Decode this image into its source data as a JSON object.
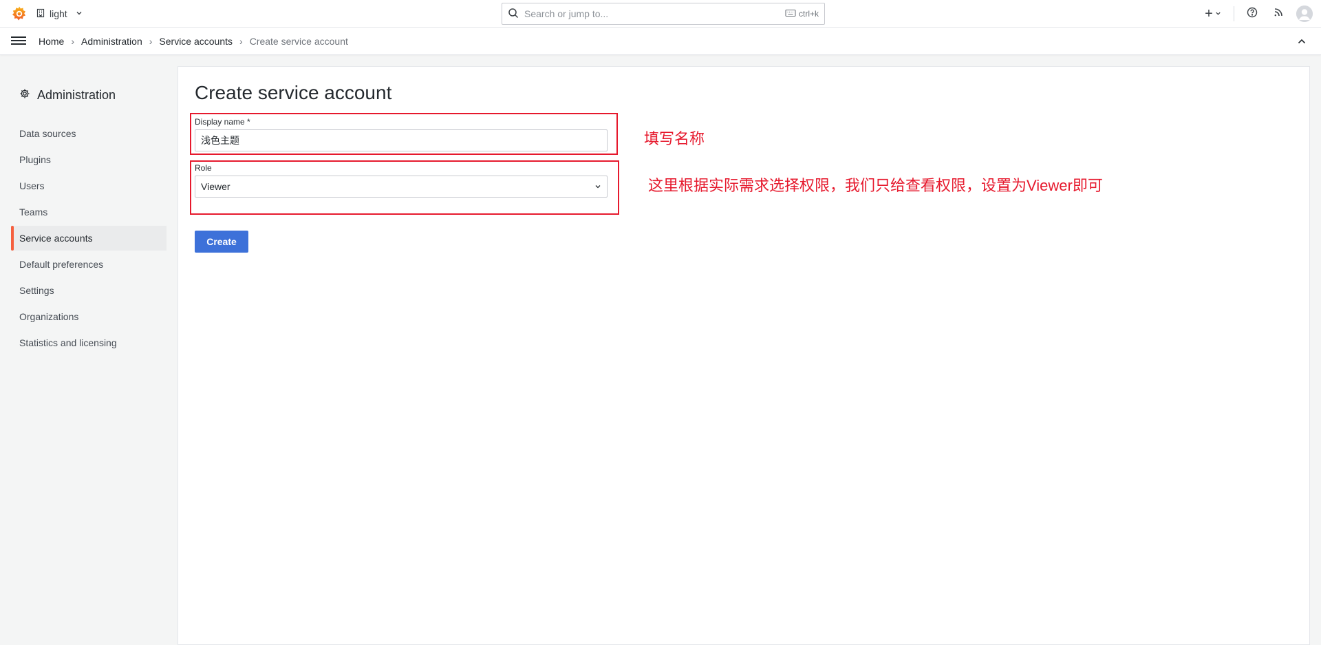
{
  "topbar": {
    "org_name": "light",
    "search_placeholder": "Search or jump to...",
    "search_shortcut": "ctrl+k",
    "new_symbol": "+"
  },
  "breadcrumb": {
    "items": [
      "Home",
      "Administration",
      "Service accounts"
    ],
    "current": "Create service account"
  },
  "sidebar": {
    "title": "Administration",
    "items": [
      {
        "label": "Data sources"
      },
      {
        "label": "Plugins"
      },
      {
        "label": "Users"
      },
      {
        "label": "Teams"
      },
      {
        "label": "Service accounts",
        "active": true
      },
      {
        "label": "Default preferences"
      },
      {
        "label": "Settings"
      },
      {
        "label": "Organizations"
      },
      {
        "label": "Statistics and licensing"
      }
    ]
  },
  "main": {
    "title": "Create service account",
    "display_name_label": "Display name *",
    "display_name_value": "浅色主题",
    "role_label": "Role",
    "role_value": "Viewer",
    "create_label": "Create"
  },
  "annotations": {
    "name_note": "填写名称",
    "role_note": "这里根据实际需求选择权限，我们只给查看权限，设置为Viewer即可"
  },
  "colors": {
    "accent": "#3d71d9",
    "active_indicator": "#f55f3e",
    "annotation": "#e6192d"
  }
}
